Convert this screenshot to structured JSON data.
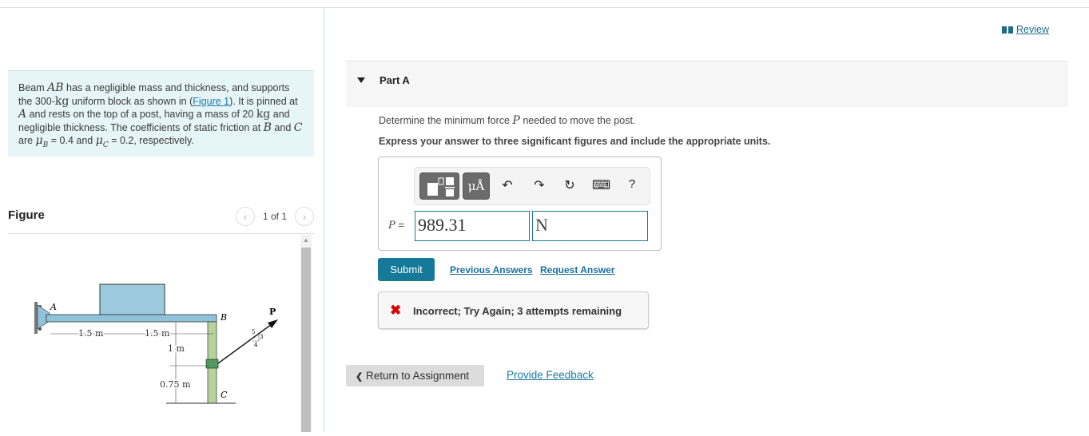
{
  "problem": {
    "segments": [
      {
        "t": "Beam "
      },
      {
        "m": "AB"
      },
      {
        "t": " has a negligible mass and thickness, and supports the 300-"
      },
      {
        "u": "kg"
      },
      {
        "t": " uniform block as shown in ("
      },
      {
        "link": "Figure 1"
      },
      {
        "t": "). It is pinned at "
      },
      {
        "m": "A"
      },
      {
        "t": " and rests on the top of a post, having a mass of 20 "
      },
      {
        "u": "kg"
      },
      {
        "t": " and negligible thickness. The coefficients of static friction at "
      },
      {
        "m": "B"
      },
      {
        "t": " and "
      },
      {
        "m": "C"
      },
      {
        "t": " are "
      },
      {
        "m": "μ",
        "sub": "B"
      },
      {
        "t": " = 0.4 and "
      },
      {
        "m": "μ",
        "sub": "C"
      },
      {
        "t": " = 0.2, respectively."
      }
    ]
  },
  "figure": {
    "title": "Figure",
    "pager": "1 of 1",
    "prev_icon": "chevron-left-icon",
    "next_icon": "chevron-right-icon",
    "labels": {
      "A": "A",
      "B": "B",
      "C": "C",
      "P": "P",
      "d1": "1.5 m",
      "d2": "1.5 m",
      "h1": "1 m",
      "h2": "0.75 m",
      "s5": "5",
      "s3": "3",
      "s4": "4"
    },
    "colors": {
      "beam": "#8fc3dc",
      "block": "#9ccbe0",
      "post": "#b5d39a",
      "collar": "#4f9a5f"
    }
  },
  "header": {
    "review_label": " Review",
    "review_icon": "book-icon"
  },
  "part_a": {
    "title": "Part A",
    "question": [
      "Determine the minimum force ",
      "P",
      " needed to move the post."
    ],
    "instruction": "Express your answer to three significant figures and include the appropriate units.",
    "toolbar": {
      "units_label": "μÅ",
      "undo_icon": "↶",
      "redo_icon": "↷",
      "reset_icon": "↻",
      "keyboard_icon": "⌨",
      "help_label": "?"
    },
    "variable": "P",
    "equals": " =",
    "value": "989.31",
    "unit": "N",
    "submit_label": "Submit",
    "previous_answers_label": "Previous Answers",
    "request_answer_label": "Request Answer",
    "feedback": {
      "icon": "✖",
      "text": "Incorrect; Try Again; 3 attempts remaining",
      "color": "#dd0000"
    }
  },
  "footer": {
    "return_label": "Return to Assignment",
    "return_icon": "❮",
    "provide_feedback_label": "Provide Feedback"
  }
}
